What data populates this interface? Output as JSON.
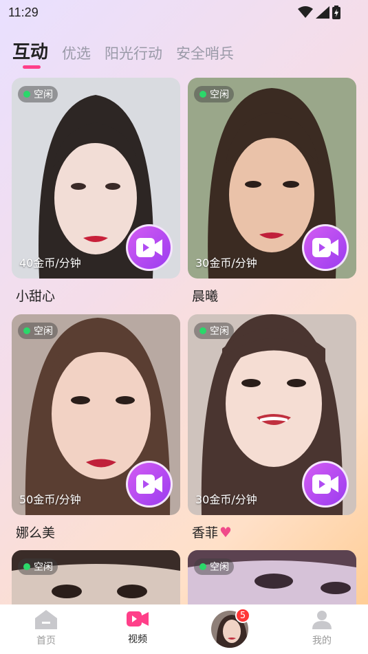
{
  "status_bar": {
    "time": "11:29"
  },
  "tabs": [
    "互动",
    "优选",
    "阳光行动",
    "安全哨兵"
  ],
  "cards": [
    {
      "status": "空闲",
      "price": "40金币/分钟",
      "name": "小甜心"
    },
    {
      "status": "空闲",
      "price": "30金币/分钟",
      "name": "晨曦"
    },
    {
      "status": "空闲",
      "price": "50金币/分钟",
      "name": "娜么美"
    },
    {
      "status": "空闲",
      "price": "30金币/分钟",
      "name": "香菲"
    },
    {
      "status": "空闲"
    },
    {
      "status": "空闲"
    }
  ],
  "bottom_nav": {
    "home": "首页",
    "video": "视频",
    "notification_count": "5",
    "mine": "我的"
  },
  "colors": {
    "accent": "#ff3f89",
    "online_dot": "#2bd86a",
    "video_button": "#b04cf2"
  }
}
